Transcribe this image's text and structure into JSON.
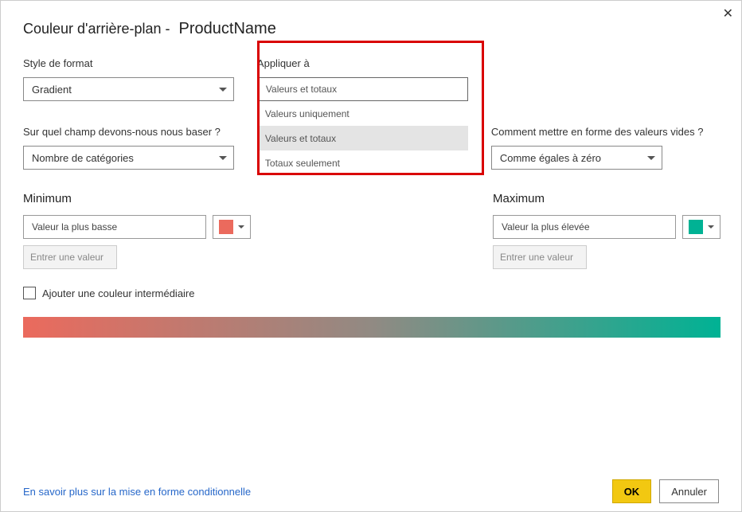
{
  "title_prefix": "Couleur d'arrière-plan -",
  "title_product": "ProductName",
  "format_style": {
    "label": "Style de format",
    "value": "Gradient"
  },
  "apply_to": {
    "label": "Appliquer à",
    "value": "Valeurs et totaux",
    "options": [
      "Valeurs uniquement",
      "Valeurs et totaux",
      "Totaux seulement"
    ]
  },
  "base_field": {
    "label": "Sur quel champ devons-nous nous baser ?",
    "value": "Nombre de catégories"
  },
  "empty_values": {
    "label": "Comment mettre en forme des valeurs vides ?",
    "value": "Comme égales à zéro"
  },
  "minimum": {
    "label": "Minimum",
    "value": "Valeur la plus basse",
    "placeholder": "Entrer une valeur",
    "color": "#eb6a5d"
  },
  "maximum": {
    "label": "Maximum",
    "value": "Valeur la plus élevée",
    "placeholder": "Entrer une valeur",
    "color": "#00b294"
  },
  "intermediate": {
    "label": "Ajouter une couleur intermédiaire"
  },
  "footer": {
    "link": "En savoir plus sur la mise en forme conditionnelle",
    "ok": "OK",
    "cancel": "Annuler"
  }
}
